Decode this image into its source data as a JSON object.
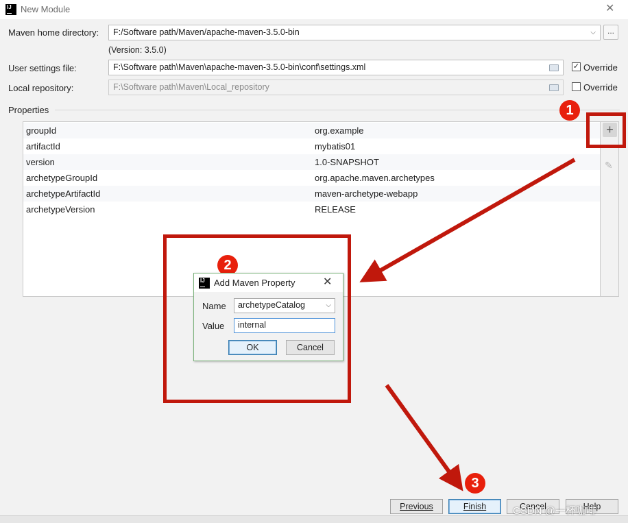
{
  "window": {
    "title": "New Module"
  },
  "maven": {
    "home_label": "Maven home directory:",
    "home_value": "F:/Software path/Maven/apache-maven-3.5.0-bin",
    "browse_label": "...",
    "version_text": "(Version: 3.5.0)",
    "settings_label": "User settings file:",
    "settings_value": "F:\\Software path\\Maven\\apache-maven-3.5.0-bin\\conf\\settings.xml",
    "settings_override_label": "Override",
    "settings_override_checked": true,
    "repo_label": "Local repository:",
    "repo_value": "F:\\Software path\\Maven\\Local_repository",
    "repo_override_label": "Override",
    "repo_override_checked": false
  },
  "properties": {
    "section_label": "Properties",
    "rows": [
      {
        "key": "groupId",
        "value": "org.example"
      },
      {
        "key": "artifactId",
        "value": "mybatis01"
      },
      {
        "key": "version",
        "value": "1.0-SNAPSHOT"
      },
      {
        "key": "archetypeGroupId",
        "value": "org.apache.maven.archetypes"
      },
      {
        "key": "archetypeArtifactId",
        "value": "maven-archetype-webapp"
      },
      {
        "key": "archetypeVersion",
        "value": "RELEASE"
      }
    ]
  },
  "dialog": {
    "title": "Add Maven Property",
    "name_label": "Name",
    "name_value": "archetypeCatalog",
    "value_label": "Value",
    "value_value": "internal",
    "ok_label": "OK",
    "cancel_label": "Cancel"
  },
  "annotations": {
    "badge1": "1",
    "badge2": "2",
    "badge3": "3",
    "color": "#c0180c"
  },
  "footer": {
    "previous_label": "Previous",
    "finish_label": "Finish",
    "cancel_label": "Cancel",
    "help_label": "Help",
    "watermark": "CSDN @一杯咖啡"
  },
  "icons": [
    "intellij-logo-icon",
    "close-icon",
    "chevron-down-icon",
    "folder-icon",
    "checkbox-icon",
    "plus-icon",
    "pencil-icon"
  ]
}
